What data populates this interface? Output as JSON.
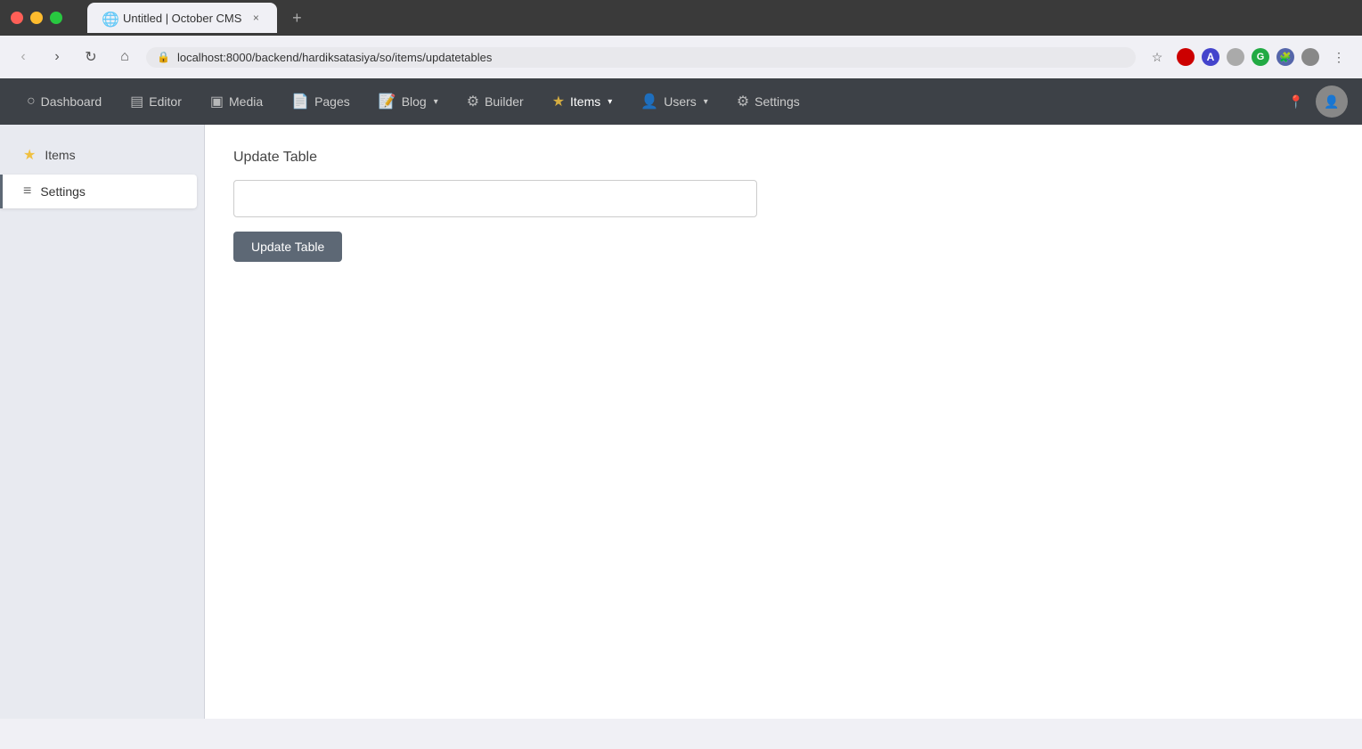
{
  "browser": {
    "tab_title": "Untitled | October CMS",
    "tab_close_label": "×",
    "new_tab_label": "+",
    "url": "localhost:8000/backend/hardiksatasiya/so/items/updatetables",
    "back_label": "‹",
    "forward_label": "›",
    "reload_label": "↻",
    "home_label": "⌂",
    "bookmark_label": "☆",
    "extensions": [
      {
        "id": "ext-red",
        "label": ""
      },
      {
        "id": "ext-blue",
        "label": "A"
      },
      {
        "id": "ext-white",
        "label": ""
      },
      {
        "id": "ext-green",
        "label": "G"
      },
      {
        "id": "ext-puzzle",
        "label": "🧩"
      },
      {
        "id": "ext-account",
        "label": ""
      }
    ],
    "more_label": "⋮"
  },
  "nav": {
    "items": [
      {
        "id": "dashboard",
        "label": "Dashboard",
        "icon": "○"
      },
      {
        "id": "editor",
        "label": "Editor",
        "icon": "▤"
      },
      {
        "id": "media",
        "label": "Media",
        "icon": "▣"
      },
      {
        "id": "pages",
        "label": "Pages",
        "icon": "📄"
      },
      {
        "id": "blog",
        "label": "Blog",
        "icon": "📝",
        "has_chevron": true
      },
      {
        "id": "builder",
        "label": "Builder",
        "icon": "⚙"
      },
      {
        "id": "items",
        "label": "Items",
        "icon": "★",
        "has_chevron": true,
        "active": true
      },
      {
        "id": "users",
        "label": "Users",
        "icon": "👤",
        "has_chevron": true
      },
      {
        "id": "settings",
        "label": "Settings",
        "icon": "⚙"
      }
    ],
    "location_icon": "📍"
  },
  "sidebar": {
    "items": [
      {
        "id": "items",
        "label": "Items",
        "icon": "★",
        "active": false
      },
      {
        "id": "settings",
        "label": "Settings",
        "icon": "≡",
        "active": true
      }
    ]
  },
  "content": {
    "section_title": "Update Table",
    "input_placeholder": "",
    "input_value": "",
    "button_label": "Update Table"
  }
}
